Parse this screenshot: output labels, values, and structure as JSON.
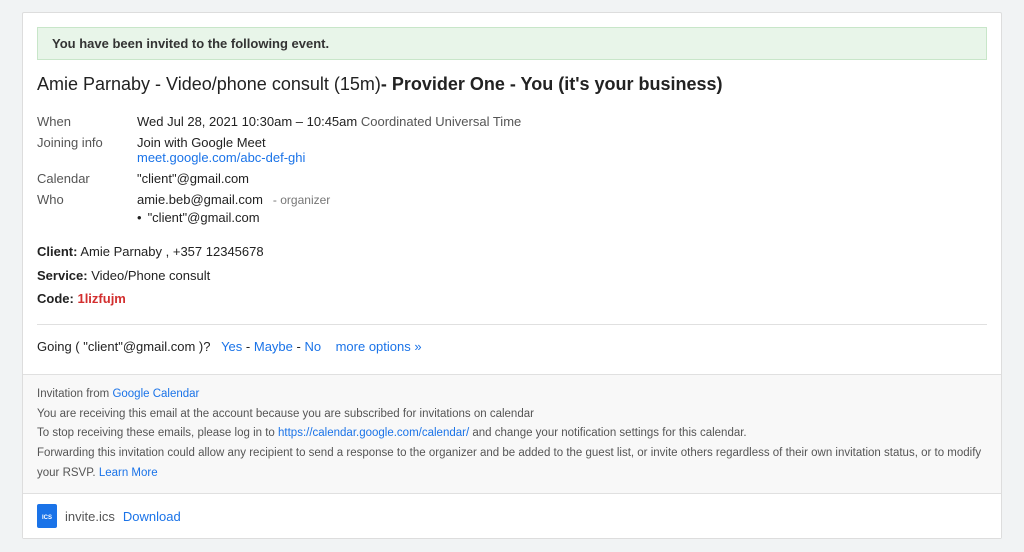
{
  "banner": {
    "text": "You have been invited to the following event."
  },
  "event": {
    "title_prefix": "Amie Parnaby - Video/phone consult (15m)",
    "title_suffix": "- Provider One - You (it's your business)",
    "when_label": "When",
    "when_value": "Wed Jul 28, 2021",
    "when_time": "10:30am – 10:45am",
    "when_tz": "Coordinated Universal Time",
    "joining_label": "Joining info",
    "joining_text": "Join with Google Meet",
    "joining_link": "meet.google.com/abc-def-ghi",
    "calendar_label": "Calendar",
    "calendar_value": "\"client\"@gmail.com",
    "who_label": "Who",
    "who_organizer": "amie.beb@gmail.com",
    "who_organizer_tag": "- organizer",
    "who_attendee": "\"client\"@gmail.com"
  },
  "client_info": {
    "client_label": "Client:",
    "client_name": "Amie Parnaby",
    "client_phone": ", +357 12345678",
    "service_label": "Service:",
    "service_value": "Video/Phone consult",
    "code_label": "Code:",
    "code_value": "1lizfujm"
  },
  "going": {
    "prefix": "Going (",
    "email": "\"client\"@gmail.com",
    "suffix": ")?",
    "yes_label": "Yes",
    "dash1": "-",
    "maybe_label": "Maybe",
    "dash2": "-",
    "no_label": "No",
    "more_label": "more options »"
  },
  "footer": {
    "invitation_prefix": "Invitation from",
    "google_calendar_link": "Google Calendar",
    "receiving_text": "You are receiving this email at the account",
    "receiving_suffix": "because you are subscribed for invitations on calendar",
    "stop_text": "To stop receiving these emails, please log in to",
    "stop_link_text": "https://calendar.google.com/calendar/",
    "stop_suffix": "and change your notification settings for this calendar.",
    "forwarding_text": "Forwarding this invitation could allow any recipient to send a response to the organizer and be added to the guest list, or invite others regardless of their own invitation status, or to modify your RSVP.",
    "learn_more": "Learn More"
  },
  "attachment": {
    "icon_label": "ICS",
    "file_name": "invite.ics",
    "download_label": "Download"
  }
}
